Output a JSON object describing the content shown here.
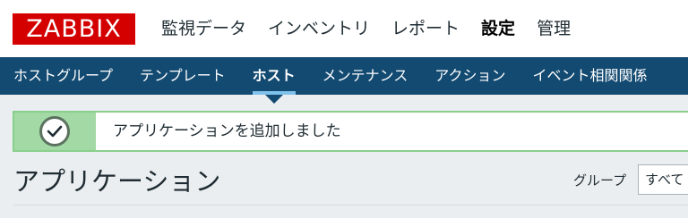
{
  "logo": "ZABBIX",
  "main_menu": [
    "監視データ",
    "インベントリ",
    "レポート",
    "設定",
    "管理"
  ],
  "main_menu_active": "設定",
  "sub_menu": [
    "ホストグループ",
    "テンプレート",
    "ホスト",
    "メンテナンス",
    "アクション",
    "イベント相関関係"
  ],
  "sub_menu_active": "ホスト",
  "message": {
    "icon": "check-icon",
    "text": "アプリケーションを追加しました"
  },
  "page_title": "アプリケーション",
  "filter": {
    "group_label": "グループ",
    "group_value": "すべて"
  },
  "colors": {
    "logo": "#d40000",
    "sub_bar": "#134a71",
    "success_border": "#89cf8c",
    "success_icon_bg": "#a3d9a5"
  }
}
